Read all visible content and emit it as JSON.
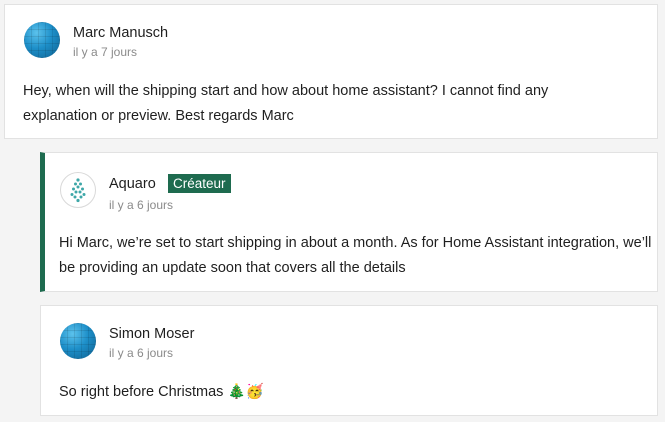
{
  "comments": [
    {
      "author": "Marc Manusch",
      "time": "il y a 7 jours",
      "text": "Hey, when will the shipping start and how about home assistant? I cannot find any explanation or preview. Best regards Marc"
    },
    {
      "author": "Aquaro",
      "badge": "Créateur",
      "time": "il y a 6 jours",
      "text": "Hi Marc, we’re set to start shipping in about a month. As for Home Assistant integration, we’ll be providing an update soon that covers all the details"
    },
    {
      "author": "Simon Moser",
      "time": "il y a 6 jours",
      "text": "So right before Christmas",
      "emojis": [
        "🎄",
        "🥳"
      ]
    }
  ],
  "colors": {
    "creator_accent": "#1e6b4f",
    "card_background": "#ffffff",
    "page_background": "#f4f4f4"
  },
  "icons": {
    "marc_avatar": "globe-avatar",
    "aquaro_avatar": "aquaro-logo",
    "simon_avatar": "globe-avatar"
  }
}
